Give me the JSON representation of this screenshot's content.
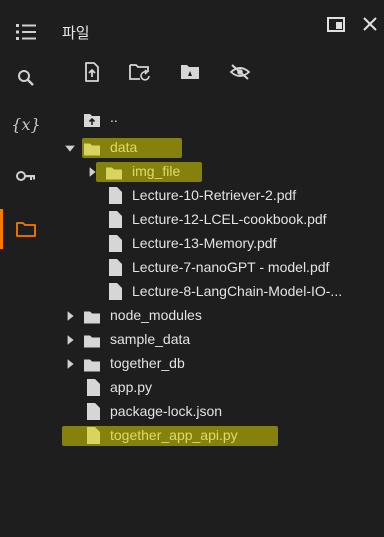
{
  "panel": {
    "title": "파일"
  },
  "icons": {
    "toc": "toc-icon",
    "search": "search-icon",
    "variables": "variables-icon",
    "secrets": "key-icon",
    "files": "folder-icon",
    "new_tab": "open-in-tab-icon",
    "close": "close-icon",
    "upload": "upload-file-icon",
    "refresh": "refresh-folder-icon",
    "drive": "mount-drive-icon",
    "hide": "hide-files-icon"
  },
  "rail": {
    "variables_label": "{x}"
  },
  "tree": {
    "parent": "..",
    "items": [
      {
        "label": "data",
        "type": "folder",
        "expanded": true,
        "depth": 0
      },
      {
        "label": "img_file",
        "type": "folder",
        "expanded": false,
        "depth": 1
      },
      {
        "label": "Lecture-10-Retriever-2.pdf",
        "type": "file",
        "depth": 1
      },
      {
        "label": "Lecture-12-LCEL-cookbook.pdf",
        "type": "file",
        "depth": 1
      },
      {
        "label": "Lecture-13-Memory.pdf",
        "type": "file",
        "depth": 1
      },
      {
        "label": "Lecture-7-nanoGPT - model.pdf",
        "type": "file",
        "depth": 1
      },
      {
        "label": "Lecture-8-LangChain-Model-IO-...",
        "type": "file",
        "depth": 1
      },
      {
        "label": "node_modules",
        "type": "folder",
        "expanded": false,
        "depth": 0
      },
      {
        "label": "sample_data",
        "type": "folder",
        "expanded": false,
        "depth": 0
      },
      {
        "label": "together_db",
        "type": "folder",
        "expanded": false,
        "depth": 0
      },
      {
        "label": "app.py",
        "type": "file",
        "depth": 0
      },
      {
        "label": "package-lock.json",
        "type": "file",
        "depth": 0
      },
      {
        "label": "together_app_api.py",
        "type": "file",
        "depth": 0
      }
    ]
  },
  "colors": {
    "background": "#1e1e1e",
    "accent": "#f57c00",
    "highlight": "#d8d600",
    "text": "#e3e3e3"
  }
}
